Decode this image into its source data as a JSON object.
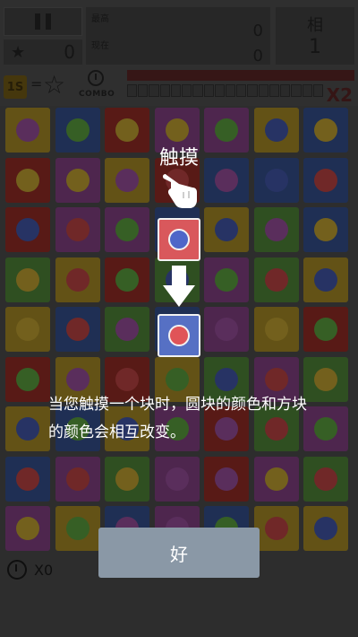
{
  "hud": {
    "star_count": "0",
    "score_label_best": "最高",
    "score_label_now": "现在",
    "best_score": "0",
    "current_score": "0",
    "level_label": "相",
    "level_value": "1",
    "time_badge": "1S",
    "equals": "=",
    "combo_label": "COMBO",
    "multiplier": "X2",
    "combo_progress_fraction": 1.0
  },
  "colors": {
    "tile_red": "#b0342d",
    "tile_blue": "#3f5fa8",
    "tile_yellow": "#c7a52c",
    "tile_green": "#5e9e43",
    "tile_purple": "#9c4d9c",
    "dot_red": "#e05050",
    "dot_blue": "#4e66c8",
    "dot_yellow": "#e6c13a",
    "dot_green": "#6cbf4a",
    "dot_purple": "#b45cb8",
    "demo_top_tile": "#d9585c",
    "demo_top_dot": "#4e66c8",
    "demo_bottom_tile": "#5670c4",
    "demo_bottom_dot": "#e05458",
    "button": "#8a98a6"
  },
  "board": {
    "columns": 7,
    "rows": [
      [
        [
          "yellow",
          "purple"
        ],
        [
          "blue",
          "green"
        ],
        [
          "red",
          "yellow"
        ],
        [
          "purple",
          "yellow"
        ],
        [
          "purple",
          "green"
        ],
        [
          "yellow",
          "blue"
        ],
        [
          "blue",
          "yellow"
        ]
      ],
      [
        [
          "red",
          "yellow"
        ],
        [
          "purple",
          "yellow"
        ],
        [
          "yellow",
          "purple"
        ],
        [
          "red",
          "red"
        ],
        [
          "blue",
          "purple"
        ],
        [
          "blue",
          "blue"
        ],
        [
          "blue",
          "red"
        ]
      ],
      [
        [
          "red",
          "blue"
        ],
        [
          "purple",
          "red"
        ],
        [
          "purple",
          "green"
        ],
        [
          "blue",
          "blue"
        ],
        [
          "yellow",
          "blue"
        ],
        [
          "green",
          "purple"
        ],
        [
          "blue",
          "yellow"
        ]
      ],
      [
        [
          "green",
          "yellow"
        ],
        [
          "yellow",
          "red"
        ],
        [
          "red",
          "green"
        ],
        [
          "green",
          "blue"
        ],
        [
          "purple",
          "green"
        ],
        [
          "green",
          "red"
        ],
        [
          "yellow",
          "blue"
        ]
      ],
      [
        [
          "yellow",
          "yellow"
        ],
        [
          "blue",
          "red"
        ],
        [
          "green",
          "purple"
        ],
        [
          "blue",
          "red"
        ],
        [
          "purple",
          "purple"
        ],
        [
          "yellow",
          "yellow"
        ],
        [
          "red",
          "green"
        ]
      ],
      [
        [
          "red",
          "green"
        ],
        [
          "yellow",
          "purple"
        ],
        [
          "red",
          "red"
        ],
        [
          "yellow",
          "green"
        ],
        [
          "green",
          "blue"
        ],
        [
          "purple",
          "red"
        ],
        [
          "green",
          "yellow"
        ]
      ],
      [
        [
          "yellow",
          "blue"
        ],
        [
          "blue",
          "green"
        ],
        [
          "yellow",
          "blue"
        ],
        [
          "purple",
          "green"
        ],
        [
          "red",
          "purple"
        ],
        [
          "green",
          "red"
        ],
        [
          "purple",
          "green"
        ]
      ],
      [
        [
          "blue",
          "red"
        ],
        [
          "purple",
          "red"
        ],
        [
          "green",
          "yellow"
        ],
        [
          "purple",
          "purple"
        ],
        [
          "red",
          "purple"
        ],
        [
          "purple",
          "yellow"
        ],
        [
          "green",
          "red"
        ]
      ],
      [
        [
          "purple",
          "yellow"
        ],
        [
          "yellow",
          "green"
        ],
        [
          "blue",
          "purple"
        ],
        [
          "purple",
          "purple"
        ],
        [
          "blue",
          "green"
        ],
        [
          "yellow",
          "red"
        ],
        [
          "yellow",
          "blue"
        ]
      ]
    ]
  },
  "tutorial": {
    "title": "触摸",
    "description": "当您触摸一个块时，圆块的颜色和方块的颜色会相互改变。",
    "ok_label": "好"
  },
  "footer": {
    "count": "X0"
  }
}
